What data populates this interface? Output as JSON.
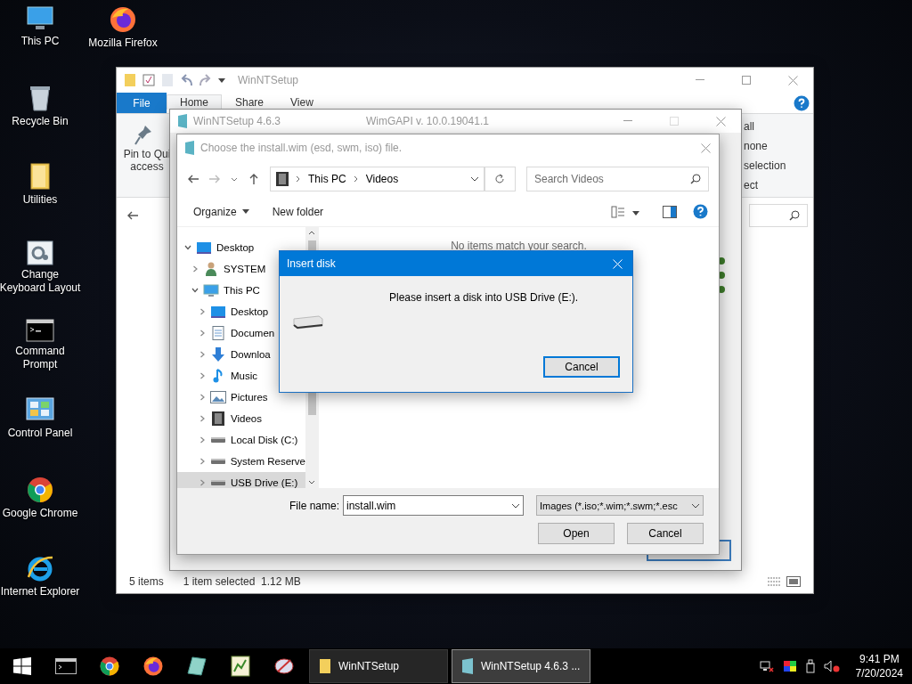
{
  "desktop_icons": [
    {
      "label": "This PC",
      "kind": "pc"
    },
    {
      "label": "Mozilla Firefox",
      "kind": "firefox"
    },
    {
      "label": "Recycle Bin",
      "kind": "recycle"
    },
    {
      "label": "Utilities",
      "kind": "folder"
    },
    {
      "label": "Change Keyboard Layout",
      "kind": "keyboard"
    },
    {
      "label": "Command Prompt",
      "kind": "cmd"
    },
    {
      "label": "Control Panel",
      "kind": "control"
    },
    {
      "label": "Google Chrome",
      "kind": "chrome"
    },
    {
      "label": "Internet Explorer",
      "kind": "ie"
    }
  ],
  "explorer": {
    "title": "WinNTSetup",
    "file_tab": "File",
    "ribbon_tabs": [
      {
        "label": "Home",
        "selected": true
      },
      {
        "label": "Share",
        "selected": false
      },
      {
        "label": "View",
        "selected": false
      }
    ],
    "pin_label": [
      "Pin to Qui",
      "access"
    ],
    "select_labels": [
      "all",
      "none",
      "selection",
      "ect"
    ],
    "status": {
      "items": "5 items",
      "selection": "1 item selected  1.12 MB"
    }
  },
  "winntsetup": {
    "title": "WinNTSetup 4.6.3",
    "version": "WimGAPI v. 10.0.19041.1"
  },
  "file_dialog": {
    "title": "Choose the install.wim (esd, swm, iso) file.",
    "address": [
      "This PC",
      "Videos"
    ],
    "search": {
      "placeholder": "Search Videos"
    },
    "organize": "Organize",
    "new_folder": "New folder",
    "tree": [
      {
        "label": "Desktop",
        "kind": "desktop",
        "expanded": true,
        "selected": false,
        "children": [
          {
            "label": "SYSTEM",
            "kind": "user",
            "expanded": false,
            "selected": false
          },
          {
            "label": "This PC",
            "kind": "pc",
            "expanded": true,
            "selected": false,
            "children": [
              {
                "label": "Desktop",
                "kind": "desktop",
                "expanded": false,
                "selected": false
              },
              {
                "label": "Documen",
                "kind": "documents",
                "expanded": false,
                "selected": false
              },
              {
                "label": "Downloa",
                "kind": "downloads",
                "expanded": false,
                "selected": false
              },
              {
                "label": "Music",
                "kind": "music",
                "expanded": false,
                "selected": false
              },
              {
                "label": "Pictures",
                "kind": "pictures",
                "expanded": false,
                "selected": false
              },
              {
                "label": "Videos",
                "kind": "videos",
                "expanded": false,
                "selected": false
              },
              {
                "label": "Local Disk (C:)",
                "kind": "drive",
                "expanded": false,
                "selected": false
              },
              {
                "label": "System Reserve",
                "kind": "drive",
                "expanded": false,
                "selected": false
              },
              {
                "label": "USB Drive (E:)",
                "kind": "drive",
                "expanded": false,
                "selected": true
              }
            ]
          }
        ]
      }
    ],
    "empty_message": "No items match your search.",
    "file_name_label": "File name:",
    "file_name": "install.wim",
    "filter": "Images (*.iso;*.wim;*.swm;*.esc",
    "buttons": [
      "Open",
      "Cancel"
    ]
  },
  "insert_disk": {
    "title": "Insert disk",
    "message": "Please insert a disk into USB Drive (E:).",
    "button": "Cancel"
  },
  "taskbar": {
    "tasks": [
      {
        "label": "WinNTSetup",
        "selected": false
      },
      {
        "label": "WinNTSetup 4.6.3  ...",
        "selected": true
      }
    ],
    "time": "9:41 PM",
    "date": "7/20/2024"
  }
}
